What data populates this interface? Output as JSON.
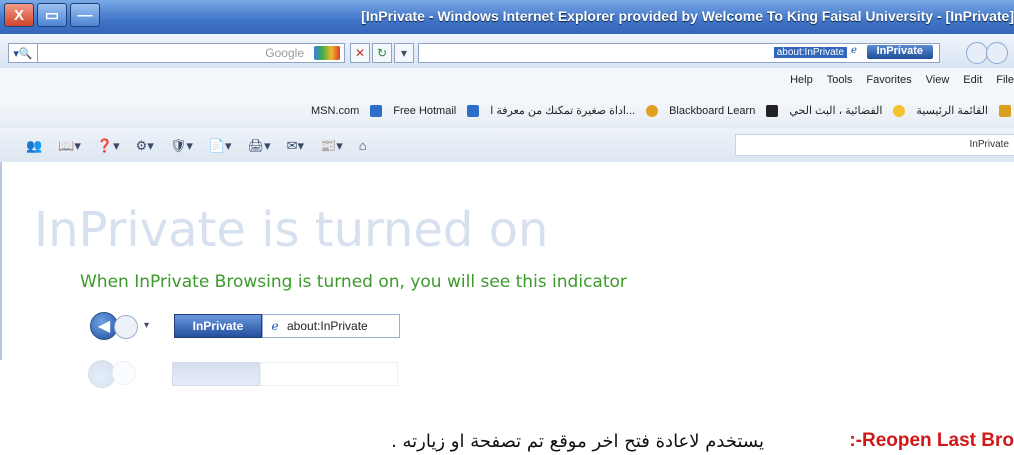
{
  "window": {
    "title": "[InPrivate - Windows Internet Explorer provided by Welcome To King Faisal University - [InPrivate]",
    "buttons": [
      "X",
      "▭",
      "—"
    ]
  },
  "search": {
    "placeholder": "Google",
    "engine_badge": "G"
  },
  "address": {
    "value": "about:InPrivate",
    "inprivate_label": "InPrivate"
  },
  "menu": {
    "items": [
      "Help",
      "Tools",
      "Favorites",
      "View",
      "Edit",
      "File"
    ]
  },
  "favorites": {
    "items": [
      "MSN.com",
      "Free Hotmail",
      "اداة صغيرة تمكنك من معرفة ا...",
      "Blackboard Learn",
      "الفضائية ، البث الحي",
      "القائمة الرئيسية"
    ]
  },
  "tab": {
    "label": "InPrivate"
  },
  "page": {
    "heading": "InPrivate is turned on",
    "subheading": "When InPrivate Browsing is turned on, you will see this indicator",
    "indicator_inprivate": "InPrivate",
    "indicator_address": "about:InPrivate"
  },
  "caption": {
    "label_en": "Reopen Last Bro",
    "label_sep": ":-",
    "text_ar": "يستخدم لاعادة فتح اخر موقع تم تصفحة او زيارته ."
  }
}
